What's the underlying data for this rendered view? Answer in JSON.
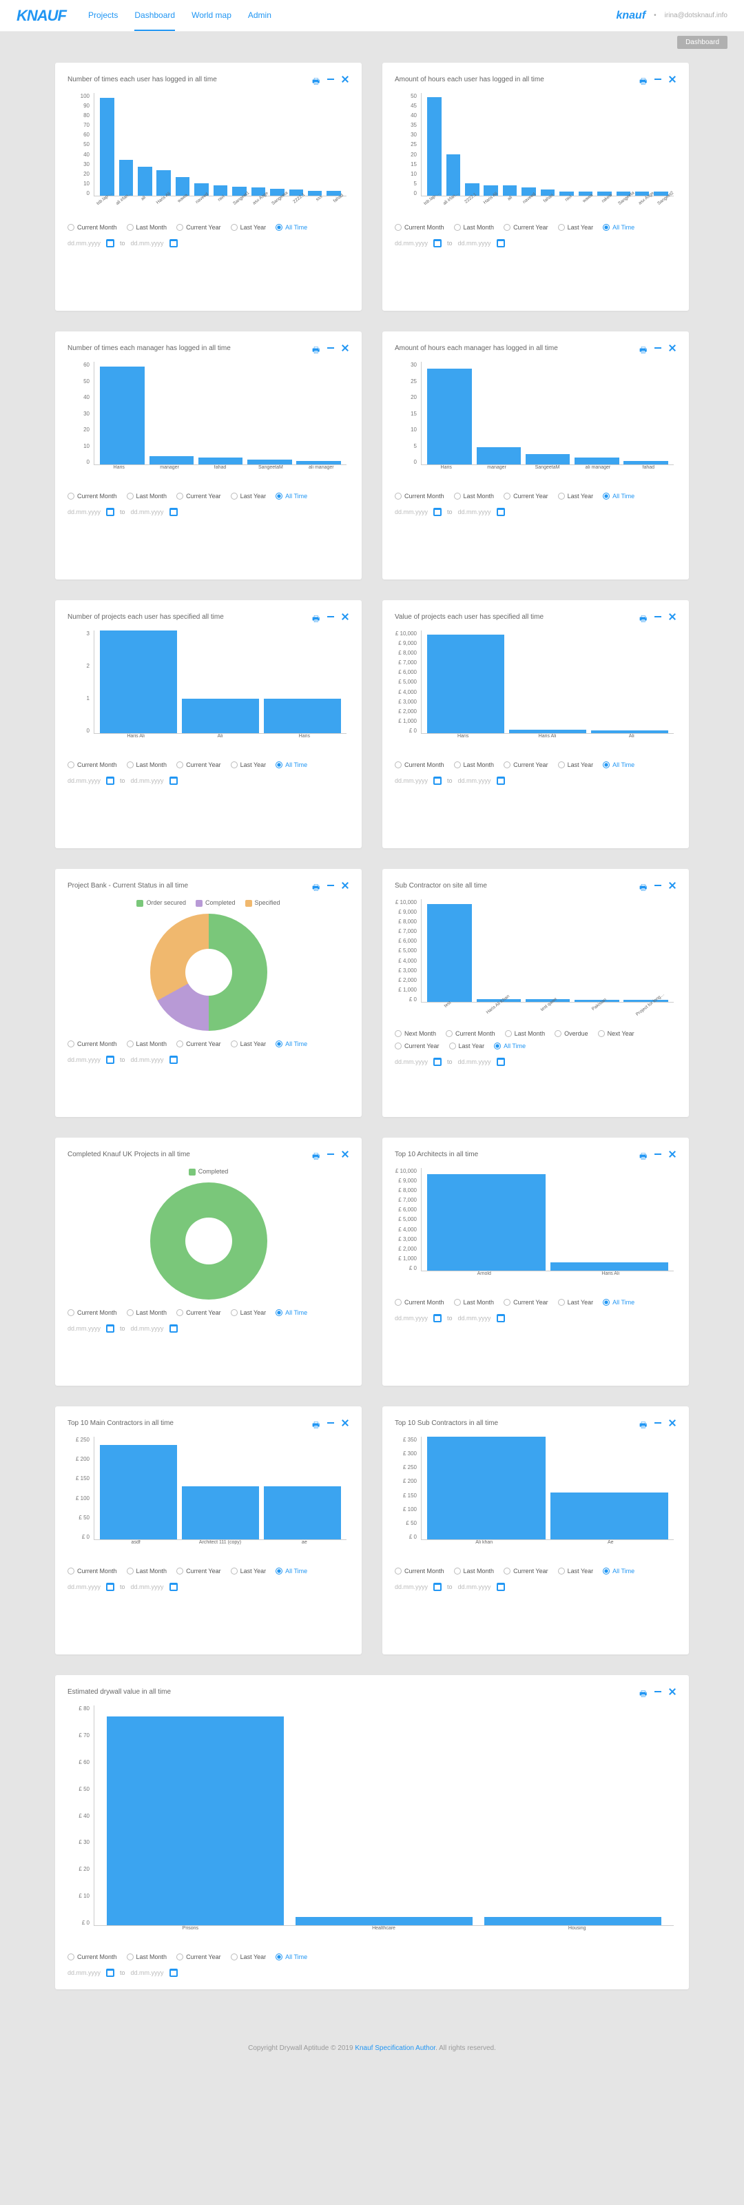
{
  "header": {
    "logo": "KNAUF",
    "nav": [
      "Projects",
      "Dashboard",
      "World map",
      "Admin"
    ],
    "active_nav": 1,
    "logo2": "knauf",
    "user_sep": "•",
    "user_email": "irina@dotsknauf.info"
  },
  "breadcrumb": "Dashboard",
  "filters_std": {
    "options": [
      "Current Month",
      "Last Month",
      "Current Year",
      "Last Year",
      "All Time"
    ],
    "selected": 4,
    "date_placeholder": "dd.mm.yyyy",
    "date_sep": "to"
  },
  "filters_sub": {
    "options": [
      "Next Month",
      "Current Month",
      "Last Month",
      "Overdue",
      "Next Year",
      "Current Year",
      "Last Year",
      "All Time"
    ],
    "selected": 7,
    "date_placeholder": "dd.mm.yyyy",
    "date_sep": "to"
  },
  "cards": [
    {
      "id": "c1",
      "title": "Number of times each user has logged in all time"
    },
    {
      "id": "c2",
      "title": "Amount of hours each user has logged in all time"
    },
    {
      "id": "c3",
      "title": "Number of times each manager has logged in all time"
    },
    {
      "id": "c4",
      "title": "Amount of hours each manager has logged in all time"
    },
    {
      "id": "c5",
      "title": "Number of projects each user has specified all time"
    },
    {
      "id": "c6",
      "title": "Value of projects each user has specified all time"
    },
    {
      "id": "c7",
      "title": "Project Bank - Current Status in all time"
    },
    {
      "id": "c8",
      "title": "Sub Contractor on site all time"
    },
    {
      "id": "c9",
      "title": "Completed Knauf UK Projects in all time"
    },
    {
      "id": "c10",
      "title": "Top 10 Architects in all time"
    },
    {
      "id": "c11",
      "title": "Top 10 Main Contractors in all time"
    },
    {
      "id": "c12",
      "title": "Top 10 Sub Contractors in all time"
    },
    {
      "id": "c13",
      "title": "Estimated drywall value in all time"
    }
  ],
  "donut7_legend": [
    "Order secured",
    "Completed",
    "Specified"
  ],
  "donut9_legend": [
    "Completed"
  ],
  "footer": {
    "pre": "Copyright Drywall Aptitude © 2019 ",
    "link": "Knauf Specification Author",
    "post": ". All rights reserved."
  },
  "chart_data": [
    {
      "id": "c1",
      "type": "bar",
      "ylim": [
        0,
        100
      ],
      "yticks": [
        100,
        90,
        80,
        70,
        60,
        50,
        40,
        30,
        20,
        10,
        0
      ],
      "categories": [
        "tsb.lap-St…",
        "ali irfan d…",
        "ali",
        "Haris Ali",
        "wawa",
        "naveed",
        "ravi",
        "Sangeet1",
        "asx Asge",
        "Sangeeta",
        "2222.1",
        "sss",
        "fahad"
      ],
      "values": [
        95,
        35,
        28,
        25,
        18,
        12,
        10,
        9,
        8,
        7,
        6,
        5,
        5
      ],
      "rot": true
    },
    {
      "id": "c2",
      "type": "bar",
      "ylim": [
        0,
        50
      ],
      "yticks": [
        50,
        45,
        40,
        35,
        30,
        25,
        20,
        15,
        10,
        5,
        0
      ],
      "categories": [
        "tsb.lap-St…",
        "ali irfan d…",
        "2222.1",
        "Haris Ali",
        "ali",
        "naveed",
        "fahari",
        "ravi",
        "wawa",
        "rakew",
        "Sangeeta",
        "asx Asge",
        "Sangeet2"
      ],
      "values": [
        48,
        20,
        6,
        5,
        5,
        4,
        3,
        2,
        2,
        2,
        2,
        2,
        2
      ],
      "rot": true
    },
    {
      "id": "c3",
      "type": "bar",
      "ylim": [
        0,
        60
      ],
      "yticks": [
        60,
        50,
        40,
        30,
        20,
        10,
        0
      ],
      "categories": [
        "Haris",
        "manager",
        "fahad",
        "SangeetaM",
        "ali manager"
      ],
      "values": [
        57,
        5,
        4,
        3,
        2
      ]
    },
    {
      "id": "c4",
      "type": "bar",
      "ylim": [
        0,
        30
      ],
      "yticks": [
        30,
        25,
        20,
        15,
        10,
        5,
        0
      ],
      "categories": [
        "Haris",
        "manager",
        "SangeetaM",
        "ali manager",
        "fahad"
      ],
      "values": [
        28,
        5,
        3,
        2,
        1
      ]
    },
    {
      "id": "c5",
      "type": "bar",
      "ylim": [
        0,
        3
      ],
      "yticks": [
        3,
        2,
        1,
        0
      ],
      "categories": [
        "Haris Ali",
        "Ali",
        "Haris"
      ],
      "values": [
        3,
        1,
        1
      ]
    },
    {
      "id": "c6",
      "type": "bar",
      "ylim": [
        0,
        10000
      ],
      "yticks": [
        "£ 10,000",
        "£ 9,000",
        "£ 8,000",
        "£ 7,000",
        "£ 6,000",
        "£ 5,000",
        "£ 4,000",
        "£ 3,000",
        "£ 2,000",
        "£ 1,000",
        "£ 0"
      ],
      "categories": [
        "Haris",
        "Haris Ali",
        "Ali"
      ],
      "values": [
        9600,
        350,
        250
      ]
    },
    {
      "id": "c7",
      "type": "pie",
      "series": [
        {
          "name": "Order secured",
          "value": 50
        },
        {
          "name": "Completed",
          "value": 17
        },
        {
          "name": "Specified",
          "value": 33
        }
      ],
      "colors": [
        "#7ac77a",
        "#b89ad6",
        "#f0b86e"
      ]
    },
    {
      "id": "c8",
      "type": "bar",
      "ylim": [
        0,
        10000
      ],
      "yticks": [
        "£ 10,000",
        "£ 9,000",
        "£ 8,000",
        "£ 7,000",
        "£ 6,000",
        "£ 5,000",
        "£ 4,000",
        "£ 3,000",
        "£ 2,000",
        "£ 1,000",
        "£ 0"
      ],
      "categories": [
        "test",
        "Haris Ali Khan",
        "test qawe",
        "Pakistan",
        "Project for long…"
      ],
      "values": [
        9500,
        300,
        250,
        220,
        200
      ],
      "rot": true
    },
    {
      "id": "c9",
      "type": "pie",
      "series": [
        {
          "name": "Completed",
          "value": 100
        }
      ],
      "colors": [
        "#7ac77a"
      ]
    },
    {
      "id": "c10",
      "type": "bar",
      "ylim": [
        0,
        10000
      ],
      "yticks": [
        "£ 10,000",
        "£ 9,000",
        "£ 8,000",
        "£ 7,000",
        "£ 6,000",
        "£ 5,000",
        "£ 4,000",
        "£ 3,000",
        "£ 2,000",
        "£ 1,000",
        "£ 0"
      ],
      "categories": [
        "Arnold",
        "Haris Ali"
      ],
      "values": [
        9400,
        800
      ]
    },
    {
      "id": "c11",
      "type": "bar",
      "ylim": [
        0,
        250
      ],
      "yticks": [
        "£ 250",
        "£ 200",
        "£ 150",
        "£ 100",
        "£ 50",
        "£ 0"
      ],
      "categories": [
        "asdf",
        "Architect 111 (copy)",
        "ae"
      ],
      "values": [
        230,
        130,
        130
      ]
    },
    {
      "id": "c12",
      "type": "bar",
      "ylim": [
        0,
        350
      ],
      "yticks": [
        "£ 350",
        "£ 300",
        "£ 250",
        "£ 200",
        "£ 150",
        "£ 100",
        "£ 50",
        "£ 0"
      ],
      "categories": [
        "Ali khan",
        "Ae"
      ],
      "values": [
        350,
        160
      ]
    },
    {
      "id": "c13",
      "type": "bar",
      "ylim": [
        0,
        80
      ],
      "yticks": [
        "£ 80",
        "£ 70",
        "£ 60",
        "£ 50",
        "£ 40",
        "£ 30",
        "£ 20",
        "£ 10",
        "£ 0"
      ],
      "categories": [
        "Prisons",
        "Healthcare",
        "Housing"
      ],
      "values": [
        76,
        3,
        3
      ]
    }
  ]
}
